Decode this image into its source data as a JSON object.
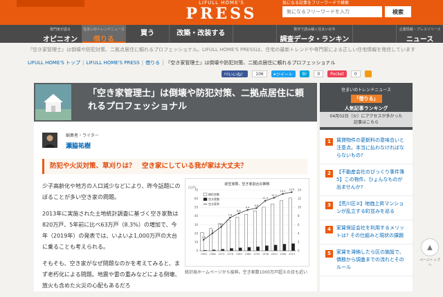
{
  "header": {
    "site_sub": "LIFULL HOME'S",
    "logo": "PRESS",
    "search_label": "気になる記事をフリーワードで検索",
    "search_placeholder": "気になるフリーワードを入力",
    "search_button": "検索"
  },
  "nav": [
    {
      "sub": "専門家が語る",
      "label": "オピニオン"
    },
    {
      "sub": "住まいのトレンドニュース",
      "label": "借りる"
    },
    {
      "sub": "",
      "label": "買う"
    },
    {
      "sub": "",
      "label": "改築・改装する"
    },
    {
      "sub": "",
      "label": ""
    },
    {
      "sub": "数字で読み解く住まいの今",
      "label": "調査データ・ランキング"
    },
    {
      "sub": "",
      "label": ""
    },
    {
      "sub": "企業情報・プレスリリース",
      "label": "ニュース"
    }
  ],
  "ticker": "『空き家管理士』は倒壊や防犯対策、二拠点居住に頼れるプロフェッショナル。LIFULL HOME'S PRESSは、住宅の最新トレンドや専門家による正しい住宅情報を発信しています【LIFULL HOME'S PRESS】",
  "breadcrumb": [
    "LIFULL HOME'S トップ",
    "LIFULL HOME'S PRESS",
    "借りる",
    "『空き家管理士』は倒壊や防犯対策、二拠点居住に頼れるプロフェッショナル"
  ],
  "social": {
    "like": "いいね！",
    "like_count": "106",
    "tweet": "ツイート",
    "hatena": "B!",
    "hatena_count": "0",
    "pocket": "Pocket",
    "pocket_count": "0"
  },
  "article": {
    "title": "「空き家管理士」は倒壊や防犯対策、二拠点居住に頼れるプロフェッショナル",
    "author_role": "編集者・ライター",
    "author_name": "瀬脇祐樹",
    "heading": "防犯や火災対策、草刈りは？　空き家にしている我が家は大丈夫？",
    "paragraphs": [
      "少子高齢化や地方の人口減少などにより、昨今話題にのぼることが多い空き家の問題。",
      "2013年に実施された土地統計調査に基づく空き家数は820万戸、5年前に比べ63万戸（8.3%）の増加で、今年（2019年）の発表では、いよいよ1,000万戸の大台に乗ることも考えられる。",
      "そもそも、空き家がなぜ問題なのかを考えてみると、まず老朽化による問題。地震や雷の重みなどによる倒壊、放火も含めた火災の心配もあるだろ"
    ],
    "figure_title": "総空家数、空き家割合の推移",
    "caption": "統計局ホームページから抜粋。空き家数1000万戸超えの日も近い"
  },
  "sidebar": {
    "subtitle": "住まいのトレンドニュース",
    "tag": "「借りる」",
    "title": "人気記事ランキング",
    "date_note": "04月02日（火）にアクセスが多かった記事はこちら",
    "ranking": [
      "賃貸物件の更新料の意味合いと注意点。本当に払わなければならないもの?",
      "【不動産会社のびっくり事件簿5】この物件、ひょんなものが出ませんか?",
      "【荒川区②】地価上昇マンションが乱立する町並みを巡る",
      "家賃保証会社を利用するメリットは? その仕組みと現状の課題",
      "家賃を滞納したら区の施設で、債務から調査までの流れとそのルール"
    ]
  },
  "page_top": "ページトップへ",
  "chart_data": {
    "type": "bar",
    "categories": [
      "1963",
      "1968",
      "1973",
      "1978",
      "1983",
      "1988",
      "1993",
      "1998",
      "2003",
      "2008",
      "2013"
    ],
    "series": [
      {
        "name": "総住宅数",
        "values": [
          21.1,
          25.6,
          31.1,
          35.5,
          38.6,
          42.0,
          45.9,
          50.2,
          53.9,
          57.6,
          60.6
        ]
      },
      {
        "name": "空き家数",
        "values": [
          0.52,
          1.03,
          1.72,
          2.68,
          3.3,
          3.94,
          4.48,
          5.76,
          6.59,
          7.57,
          8.2
        ]
      }
    ],
    "line": {
      "name": "空き家率",
      "values": [
        2.5,
        4.0,
        5.5,
        7.6,
        8.6,
        9.4,
        9.8,
        11.5,
        12.2,
        13.1,
        13.5
      ]
    },
    "ylabel": "(万戸)",
    "ylim": [
      0,
      70
    ],
    "y2lim": [
      0,
      14
    ]
  },
  "colors": {
    "accent": "#ea5a0e",
    "nav": "#4a4a4a",
    "link": "#0066b4"
  }
}
